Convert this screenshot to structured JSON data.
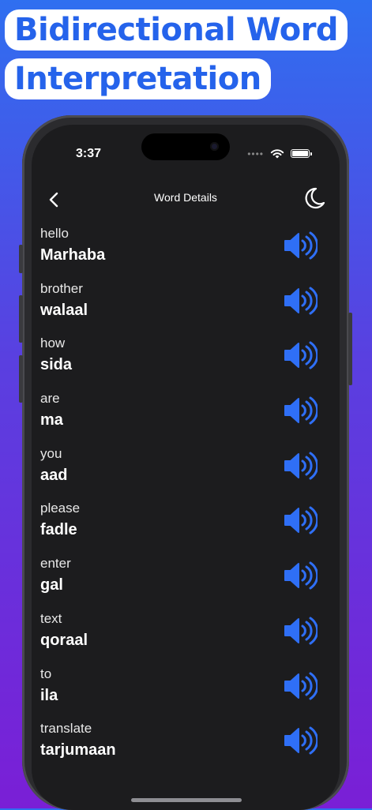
{
  "headline": {
    "line1": "Bidirectional Word",
    "line2": "Interpretation"
  },
  "status_bar": {
    "time": "3:37",
    "dots": "••••"
  },
  "navbar": {
    "title": "Word Details",
    "back_icon": "chevron-left-icon",
    "theme_icon": "moon-icon"
  },
  "colors": {
    "accent": "#2563eb",
    "speaker": "#2f6ff6",
    "background": "#1c1c1e"
  },
  "words": [
    {
      "en": "hello",
      "so": "Marhaba"
    },
    {
      "en": "brother",
      "so": "walaal"
    },
    {
      "en": "how",
      "so": "sida"
    },
    {
      "en": "are",
      "so": "ma"
    },
    {
      "en": "you",
      "so": "aad"
    },
    {
      "en": "please",
      "so": "fadle"
    },
    {
      "en": "enter",
      "so": "gal"
    },
    {
      "en": "text",
      "so": "qoraal"
    },
    {
      "en": "to",
      "so": "ila"
    },
    {
      "en": "translate",
      "so": "tarjumaan"
    }
  ]
}
